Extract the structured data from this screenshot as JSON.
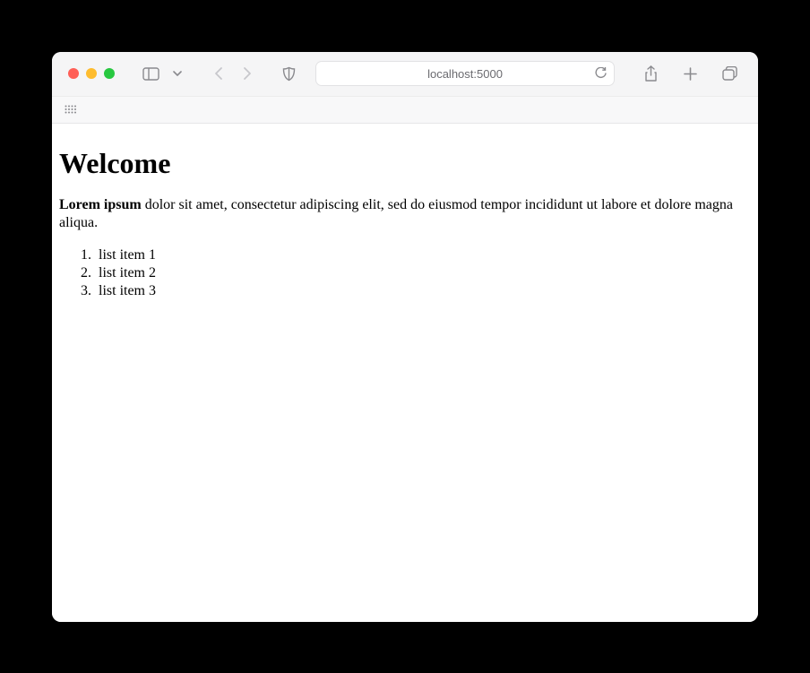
{
  "browser": {
    "url": "localhost:5000"
  },
  "page": {
    "heading": "Welcome",
    "paragraph": {
      "bold": "Lorem ipsum",
      "rest": " dolor sit amet, consectetur adipiscing elit, sed do eiusmod tempor incididunt ut labore et dolore magna aliqua."
    },
    "list": [
      "list item 1",
      "list item 2",
      "list item 3"
    ]
  }
}
